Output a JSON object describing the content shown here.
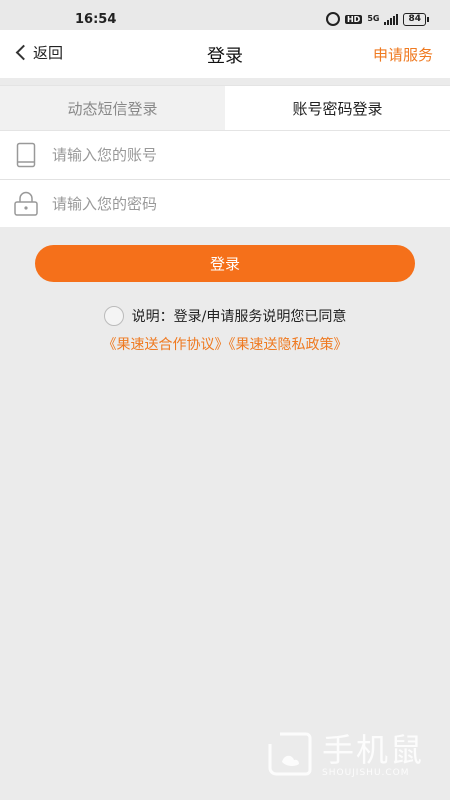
{
  "status_bar": {
    "time": "16:54",
    "network": "5G",
    "battery": "84",
    "hd_label": "HD",
    "icons": [
      "alarm-icon",
      "hd-icon",
      "signal-icon",
      "battery-icon"
    ]
  },
  "nav": {
    "back_label": "返回",
    "title": "登录",
    "action_label": "申请服务"
  },
  "tabs": [
    {
      "label": "动态短信登录",
      "active": false
    },
    {
      "label": "账号密码登录",
      "active": true
    }
  ],
  "form": {
    "account": {
      "placeholder": "请输入您的账号",
      "value": "",
      "icon": "phone-icon"
    },
    "password": {
      "placeholder": "请输入您的密码",
      "value": "",
      "icon": "lock-icon"
    }
  },
  "login_button": "登录",
  "agreement": {
    "checked": false,
    "text": "说明：登录/申请服务说明您已同意",
    "links": [
      "《果速送合作协议》",
      "《果速送隐私政策》"
    ]
  },
  "watermark": {
    "cn": "手机鼠",
    "en": "SHOUJISHU.COM"
  },
  "colors": {
    "accent": "#f5701a",
    "link": "#ef7a21",
    "background": "#ebebeb"
  }
}
